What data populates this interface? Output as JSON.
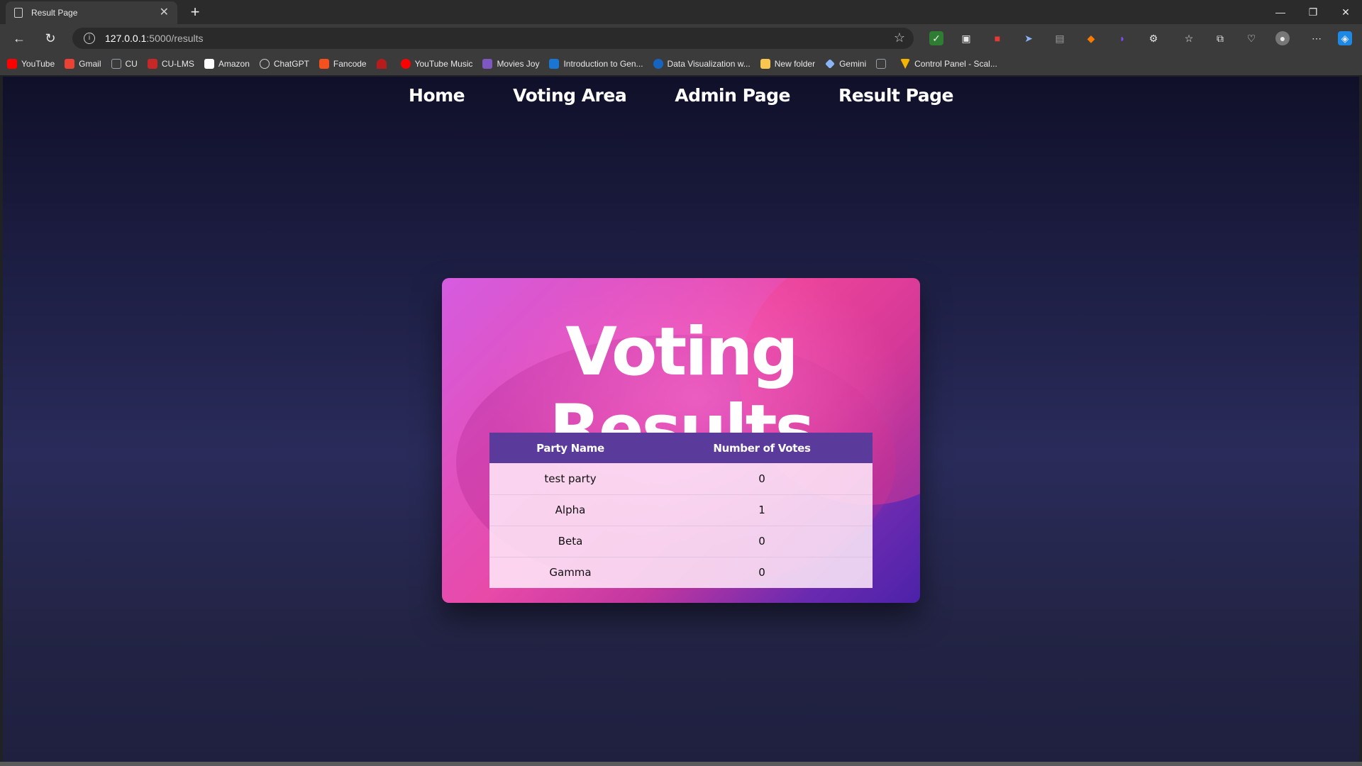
{
  "browser": {
    "tab_title": "Result Page",
    "url_host": "127.0.0.1",
    "url_path": ":5000/results",
    "bookmarks": [
      {
        "label": "YouTube",
        "color": "#ff0000"
      },
      {
        "label": "Gmail",
        "color": "#ea4335"
      },
      {
        "label": "CU",
        "color": "#9aa0a6"
      },
      {
        "label": "CU-LMS",
        "color": "#c62828"
      },
      {
        "label": "Amazon",
        "color": "#ffffff"
      },
      {
        "label": "ChatGPT",
        "color": "#cfcfcf"
      },
      {
        "label": "Fancode",
        "color": "#f4511e"
      },
      {
        "label": "",
        "color": "#b71c1c"
      },
      {
        "label": "YouTube Music",
        "color": "#ff0000"
      },
      {
        "label": "Movies Joy",
        "color": "#7e57c2"
      },
      {
        "label": "Introduction to Gen...",
        "color": "#1976d2"
      },
      {
        "label": "Data Visualization w...",
        "color": "#1565c0"
      },
      {
        "label": "New folder",
        "color": "#f9c74f"
      },
      {
        "label": "Gemini",
        "color": "#8ab4f8"
      },
      {
        "label": "",
        "color": "#9aa0a6"
      },
      {
        "label": "Control Panel - Scal...",
        "color": "#f4b400"
      }
    ]
  },
  "nav": {
    "home": "Home",
    "voting": "Voting Area",
    "admin": "Admin Page",
    "result": "Result Page"
  },
  "card": {
    "title": "Voting Results",
    "headers": {
      "party": "Party Name",
      "votes": "Number of Votes"
    },
    "rows": [
      {
        "party": "test party",
        "votes": "0"
      },
      {
        "party": "Alpha",
        "votes": "1"
      },
      {
        "party": "Beta",
        "votes": "0"
      },
      {
        "party": "Gamma",
        "votes": "0"
      }
    ]
  }
}
